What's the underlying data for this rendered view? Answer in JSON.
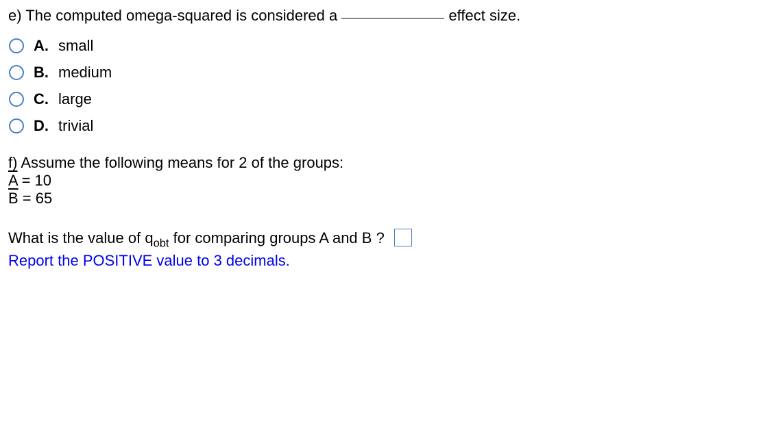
{
  "questionE": {
    "prefix": "e) The computed omega-squared is considered a ",
    "suffix": " effect size.",
    "options": [
      {
        "letter": "A.",
        "text": "small"
      },
      {
        "letter": "B.",
        "text": "medium"
      },
      {
        "letter": "C.",
        "text": "large"
      },
      {
        "letter": "D.",
        "text": "trivial"
      }
    ]
  },
  "questionF": {
    "intro": "f) Assume the following means for 2 of the groups:",
    "meanA_var": "A",
    "meanA_rest": " = 10",
    "meanB_var": "B",
    "meanB_rest": " = 65",
    "prompt_before": "What is the value of q",
    "prompt_sub": "obt",
    "prompt_after": " for comparing groups A and B ?",
    "instruction": "Report the POSITIVE value to 3 decimals."
  }
}
